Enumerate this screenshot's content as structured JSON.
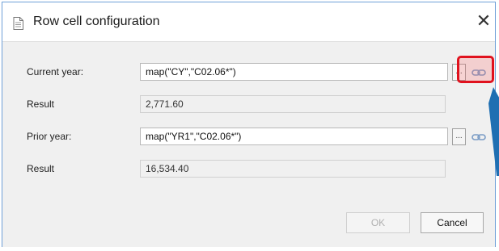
{
  "window": {
    "title": "Row cell configuration",
    "close_symbol": "✕"
  },
  "fields": {
    "current_year_label": "Current year:",
    "current_year_value": "map(\"CY\",\"C02.06*\")",
    "result1_label": "Result",
    "result1_value": "2,771.60",
    "prior_year_label": "Prior year:",
    "prior_year_value": "map(\"YR1\",\"C02.06*\")",
    "result2_label": "Result",
    "result2_value": "16,534.40",
    "browse_label": "..."
  },
  "buttons": {
    "ok_label": "OK",
    "cancel_label": "Cancel"
  },
  "colors": {
    "highlight": "#e0121e",
    "arrow": "#1f6fb2",
    "link_icon": "#7a9cc6"
  }
}
